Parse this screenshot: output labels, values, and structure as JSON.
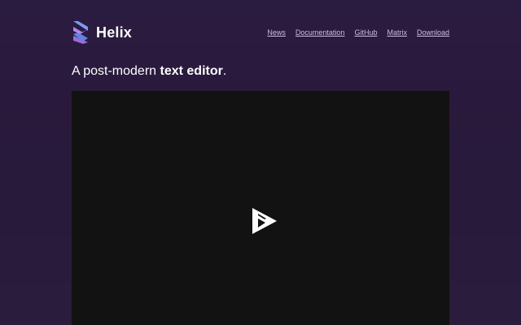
{
  "header": {
    "brand_name": "Helix",
    "logo_icon": "helix-logo-icon",
    "nav": [
      {
        "label": "News"
      },
      {
        "label": "Documentation"
      },
      {
        "label": "GitHub"
      },
      {
        "label": "Matrix"
      },
      {
        "label": "Download"
      }
    ]
  },
  "hero": {
    "tagline_prefix": "A post-modern ",
    "tagline_bold": "text editor",
    "tagline_suffix": "."
  },
  "video": {
    "play_icon": "asciinema-play-icon"
  },
  "colors": {
    "background": "#281a3a",
    "video_background": "#121212",
    "logo_blue": "#5a86e8",
    "logo_purple": "#9a6cd8",
    "nav_link": "#c9c0dc"
  }
}
